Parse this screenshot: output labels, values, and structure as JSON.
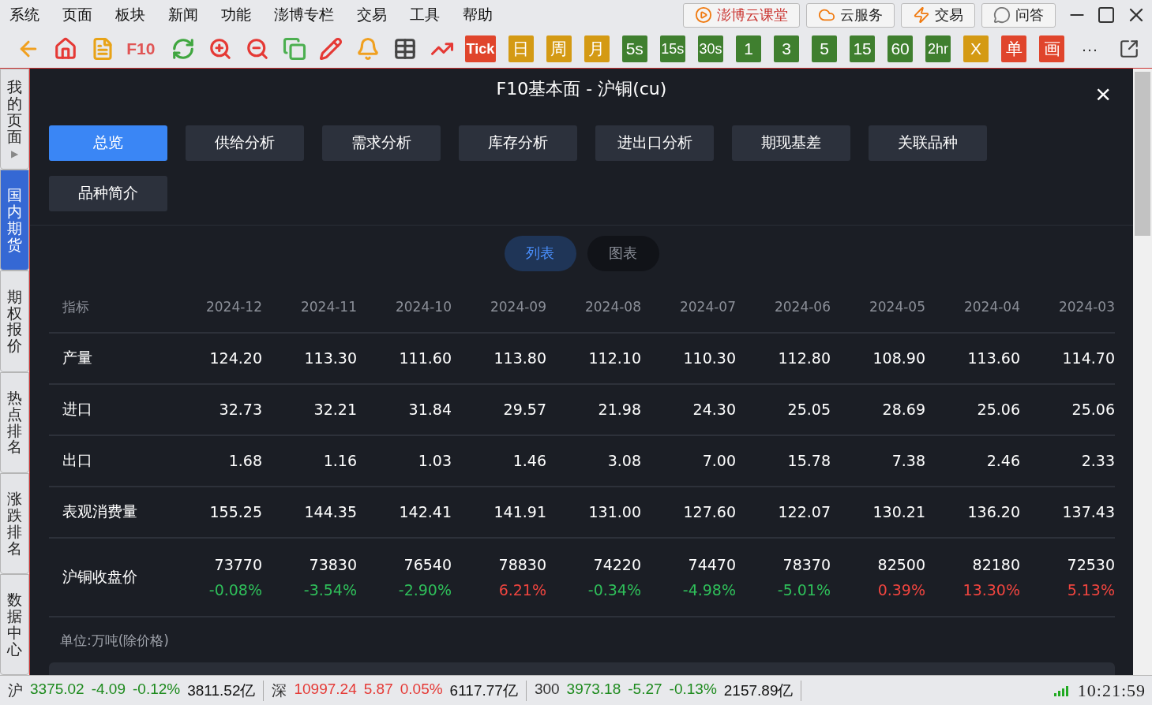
{
  "menu": [
    "系统",
    "页面",
    "板块",
    "新闻",
    "功能",
    "澎博专栏",
    "交易",
    "工具",
    "帮助"
  ],
  "top_buttons": [
    {
      "kind": "class",
      "label": "澎博云课堂"
    },
    {
      "kind": "cloud",
      "label": "云服务"
    },
    {
      "kind": "bolt",
      "label": "交易"
    },
    {
      "kind": "chat",
      "label": "问答"
    }
  ],
  "toolbar": [
    {
      "kind": "back"
    },
    {
      "kind": "home"
    },
    {
      "kind": "note"
    },
    {
      "kind": "text-red",
      "label": "F10"
    },
    {
      "kind": "refresh"
    },
    {
      "kind": "zoom-in"
    },
    {
      "kind": "zoom-out"
    },
    {
      "kind": "windows"
    },
    {
      "kind": "pen"
    },
    {
      "kind": "bell"
    },
    {
      "kind": "table"
    },
    {
      "kind": "trend"
    },
    {
      "kind": "red",
      "label": "Tick"
    },
    {
      "kind": "gold",
      "label": "日"
    },
    {
      "kind": "gold",
      "label": "周"
    },
    {
      "kind": "gold",
      "label": "月"
    },
    {
      "kind": "green",
      "label": "5s"
    },
    {
      "kind": "green",
      "label": "15s"
    },
    {
      "kind": "green",
      "label": "30s"
    },
    {
      "kind": "green",
      "label": "1"
    },
    {
      "kind": "green",
      "label": "3"
    },
    {
      "kind": "green",
      "label": "5"
    },
    {
      "kind": "green",
      "label": "15"
    },
    {
      "kind": "green",
      "label": "60"
    },
    {
      "kind": "green",
      "label": "2hr"
    },
    {
      "kind": "gold",
      "label": "X"
    },
    {
      "kind": "red",
      "label": "单"
    },
    {
      "kind": "red",
      "label": "画"
    },
    {
      "kind": "more",
      "label": "···"
    }
  ],
  "side_tabs": [
    {
      "label": "我的页面",
      "selected": false,
      "arrow": "▶"
    },
    {
      "label": "国内期货",
      "selected": true
    },
    {
      "label": "期权报价",
      "selected": false
    },
    {
      "label": "热点排名",
      "selected": false
    },
    {
      "label": "涨跌排名",
      "selected": false
    },
    {
      "label": "数据中心",
      "selected": false
    }
  ],
  "dialog": {
    "title": "F10基本面 - 沪铜(cu)",
    "close": "×"
  },
  "tabs": [
    {
      "label": "总览",
      "selected": true
    },
    {
      "label": "供给分析",
      "selected": false
    },
    {
      "label": "需求分析",
      "selected": false
    },
    {
      "label": "库存分析",
      "selected": false
    },
    {
      "label": "进出口分析",
      "selected": false
    },
    {
      "label": "期现基差",
      "selected": false
    },
    {
      "label": "关联品种",
      "selected": false
    },
    {
      "label": "品种简介",
      "selected": false
    }
  ],
  "view_toggle": [
    {
      "label": "列表",
      "selected": true
    },
    {
      "label": "图表",
      "selected": false
    }
  ],
  "table": {
    "columns": [
      "指标",
      "2024-12",
      "2024-11",
      "2024-10",
      "2024-09",
      "2024-08",
      "2024-07",
      "2024-06",
      "2024-05",
      "2024-04",
      "2024-03"
    ],
    "rows": [
      {
        "name": "产量",
        "values": [
          "124.20",
          "113.30",
          "111.60",
          "113.80",
          "112.10",
          "110.30",
          "112.80",
          "108.90",
          "113.60",
          "114.70"
        ]
      },
      {
        "name": "进口",
        "values": [
          "32.73",
          "32.21",
          "31.84",
          "29.57",
          "21.98",
          "24.30",
          "25.05",
          "28.69",
          "25.06",
          "25.06"
        ]
      },
      {
        "name": "出口",
        "values": [
          "1.68",
          "1.16",
          "1.03",
          "1.46",
          "3.08",
          "7.00",
          "15.78",
          "7.38",
          "2.46",
          "2.33"
        ]
      },
      {
        "name": "表观消费量",
        "values": [
          "155.25",
          "144.35",
          "142.41",
          "141.91",
          "131.00",
          "127.60",
          "122.07",
          "130.21",
          "136.20",
          "137.43"
        ]
      },
      {
        "name": "沪铜收盘价",
        "values": [
          "73770",
          "73830",
          "76540",
          "78830",
          "74220",
          "74470",
          "78370",
          "82500",
          "82180",
          "72530"
        ],
        "changes": [
          {
            "text": "-0.08%",
            "color": "#2fbf5a"
          },
          {
            "text": "-3.54%",
            "color": "#2fbf5a"
          },
          {
            "text": "-2.90%",
            "color": "#2fbf5a"
          },
          {
            "text": "6.21%",
            "color": "#f0453f"
          },
          {
            "text": "-0.34%",
            "color": "#2fbf5a"
          },
          {
            "text": "-4.98%",
            "color": "#2fbf5a"
          },
          {
            "text": "-5.01%",
            "color": "#2fbf5a"
          },
          {
            "text": "0.39%",
            "color": "#f0453f"
          },
          {
            "text": "13.30%",
            "color": "#f0453f"
          },
          {
            "text": "5.13%",
            "color": "#f0453f"
          }
        ]
      }
    ],
    "unit": "单位:万吨(除价格)"
  },
  "status": [
    {
      "market": "沪",
      "price": "3375.02",
      "change": "-4.09",
      "pct": "-0.12%",
      "amount": "3811.52亿",
      "color": "#1d8a1d"
    },
    {
      "market": "深",
      "price": "10997.24",
      "change": "5.87",
      "pct": "0.05%",
      "amount": "6117.77亿",
      "color": "#e53935"
    },
    {
      "market": "300",
      "price": "3973.18",
      "change": "-5.27",
      "pct": "-0.13%",
      "amount": "2157.89亿",
      "color": "#1d8a1d"
    }
  ],
  "clock": "10:21:59"
}
